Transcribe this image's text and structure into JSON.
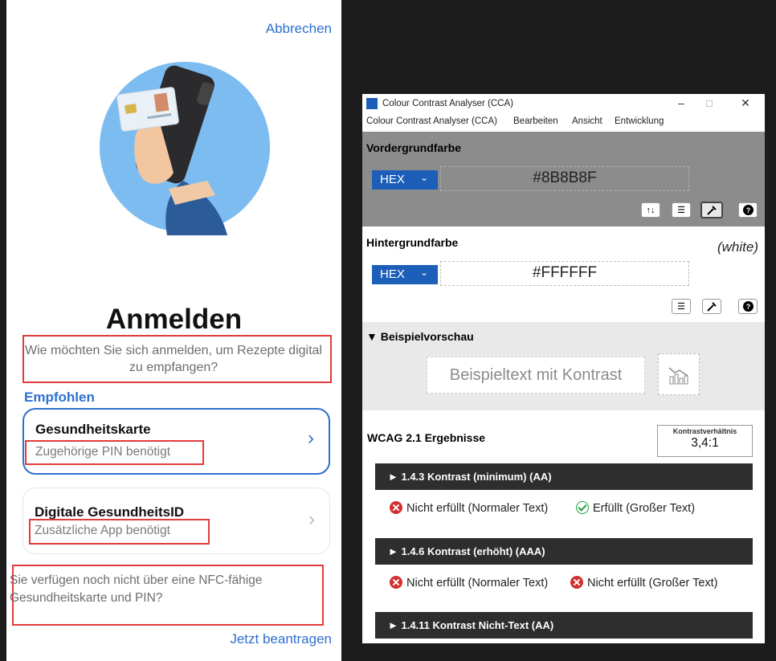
{
  "app": {
    "cancel_label": "Abbrechen",
    "title": "Anmelden",
    "subtitle": "Wie möchten Sie sich anmelden, um Rezepte digital zu empfangen?",
    "section_label": "Empfohlen",
    "options": [
      {
        "title": "Gesundheitskarte",
        "subtitle": "Zugehörige PIN benötigt",
        "chevron": "›"
      },
      {
        "title": "Digitale GesundheitsID",
        "subtitle": "Zusätzliche App benötigt",
        "chevron": "›"
      }
    ],
    "nfc_text": "Sie verfügen noch nicht über eine NFC-fähige Gesundheitskarte und PIN?",
    "apply_label": "Jetzt beantragen",
    "accent_color": "#2e6fcf",
    "highlight_color": "#e23b3b"
  },
  "cca": {
    "window_title": "Colour Contrast Analyser (CCA)",
    "window_buttons": [
      "–",
      "☐",
      "✕"
    ],
    "menu": [
      "Colour Contrast Analyser (CCA)",
      "Bearbeiten",
      "Ansicht",
      "Entwicklung"
    ],
    "foreground": {
      "label": "Vordergrundfarbe",
      "format": "HEX",
      "value": "#8B8B8F"
    },
    "background": {
      "label": "Hintergrundfarbe",
      "name": "(white)",
      "format": "HEX",
      "value": "#FFFFFF"
    },
    "preview": {
      "label": "▼ Beispielvorschau",
      "sample_text": "Beispieltext mit Kontrast"
    },
    "results": {
      "title": "WCAG 2.1 Ergebnisse",
      "ratio_label": "Kontrastverhältnis",
      "ratio_value": "3,4:1",
      "criteria": [
        {
          "label": "► 1.4.3 Kontrast (minimum) (AA)",
          "normal": {
            "status": "fail",
            "text": "Nicht erfüllt (Normaler Text)"
          },
          "large": {
            "status": "pass",
            "text": "Erfüllt (Großer Text)"
          }
        },
        {
          "label": "► 1.4.6 Kontrast (erhöht) (AAA)",
          "normal": {
            "status": "fail",
            "text": "Nicht erfüllt (Normaler Text)"
          },
          "large": {
            "status": "fail",
            "text": "Nicht erfüllt (Großer Text)"
          }
        },
        {
          "label": "► 1.4.11 Kontrast Nicht-Text (AA)"
        }
      ]
    }
  }
}
